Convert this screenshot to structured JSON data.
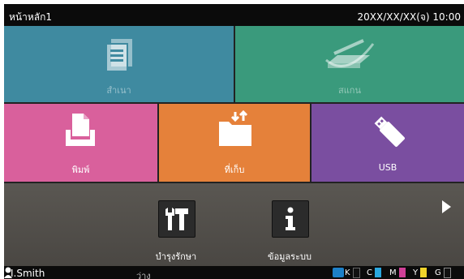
{
  "header": {
    "title": "หน้าหลัก1",
    "datetime": "20XX/XX/XX(จ) 10:00"
  },
  "tiles": {
    "copy": {
      "label": "สำเนา",
      "icon": "copy-document-icon"
    },
    "scan": {
      "label": "สแกน",
      "icon": "scanner-icon"
    },
    "print": {
      "label": "พิมพ์",
      "icon": "print-tray-icon"
    },
    "storage": {
      "label": "ที่เก็บ",
      "icon": "folder-transfer-icon"
    },
    "usb": {
      "label": "USB",
      "icon": "usb-drive-icon"
    }
  },
  "tools": {
    "maintenance": {
      "label": "บำรุงรักษา",
      "icon": "tools-icon"
    },
    "info": {
      "label": "ข้อมูลระบบ",
      "icon": "info-icon"
    }
  },
  "status": {
    "user": "I.Smith",
    "state": "ว่าง",
    "inks": [
      {
        "name": "K",
        "color": "#111111"
      },
      {
        "name": "C",
        "color": "#2aa7df"
      },
      {
        "name": "M",
        "color": "#d13f97"
      },
      {
        "name": "Y",
        "color": "#f1d32a"
      },
      {
        "name": "G",
        "color": "#8a8a8a"
      }
    ]
  },
  "colors": {
    "copy": "#3f8aa0",
    "scan": "#3a9a7c",
    "print": "#d9609c",
    "storage": "#e5813a",
    "usb": "#7a4ea0"
  }
}
